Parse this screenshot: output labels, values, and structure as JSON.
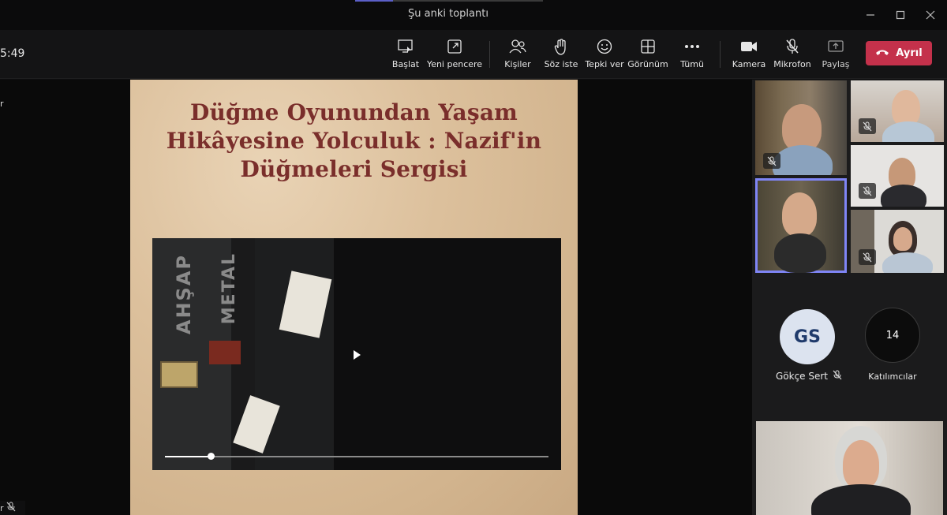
{
  "window": {
    "title": "Şu anki toplantı"
  },
  "toolbar": {
    "timer": "5:49",
    "buttons": [
      {
        "icon": "share-screen-icon",
        "label": "Başlat"
      },
      {
        "icon": "new-window-icon",
        "label": "Yeni pencere"
      },
      {
        "icon": "people-icon",
        "label": "Kişiler"
      },
      {
        "icon": "raise-hand-icon",
        "label": "Söz iste"
      },
      {
        "icon": "reaction-icon",
        "label": "Tepki ver"
      },
      {
        "icon": "view-icon",
        "label": "Görünüm"
      },
      {
        "icon": "more-icon",
        "label": "Tümü"
      },
      {
        "icon": "camera-icon",
        "label": "Kamera"
      },
      {
        "icon": "mic-muted-icon",
        "label": "Mikrofon"
      },
      {
        "icon": "share-icon",
        "label": "Paylaş"
      }
    ],
    "leave_label": "Ayrıl",
    "leave_color": "#c4314b"
  },
  "stage": {
    "left_edge_text": "r",
    "bottom_left_text": "r",
    "slide": {
      "title_lines": [
        "Düğme Oyunundan Yaşam",
        "Hikâyesine Yolculuk : Nazif'in",
        "Düğmeleri Sergisi"
      ],
      "title_color": "#7a2e2b",
      "video": {
        "scene_text_1": "AHŞAP",
        "scene_text_2": "METAL",
        "progress": 0.12
      }
    }
  },
  "gallery": {
    "avatar_initials": "GS",
    "avatar_name": "Gökçe Sert",
    "participants_count": "14",
    "participants_label": "Katılımcılar",
    "accent_color": "#7f85f5"
  }
}
